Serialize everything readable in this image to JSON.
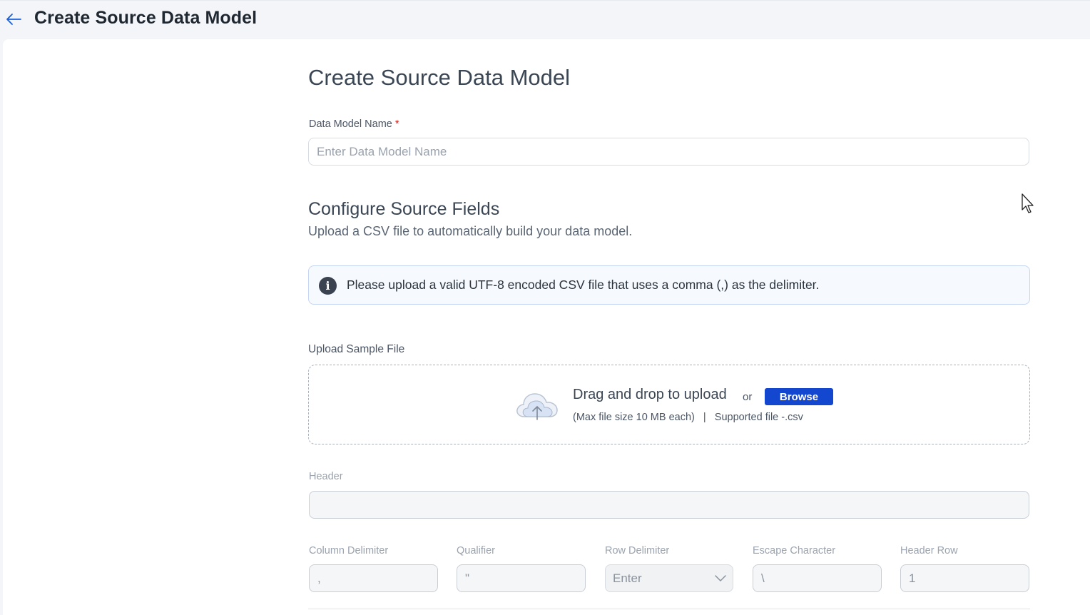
{
  "header": {
    "title": "Create Source Data Model",
    "back_icon": "arrow-left-icon"
  },
  "form": {
    "title": "Create Source Data Model",
    "data_model_name": {
      "label": "Data Model Name",
      "required_mark": "*",
      "value": "",
      "placeholder": "Enter Data Model Name"
    }
  },
  "configure": {
    "title": "Configure Source Fields",
    "subtitle": "Upload a CSV file to automatically build your data model.",
    "info_icon": "info-icon",
    "info_glyph": "i",
    "info_text": "Please upload a valid UTF-8 encoded CSV file that uses a comma (,) as the delimiter."
  },
  "upload": {
    "label": "Upload Sample File",
    "icon": "cloud-upload-icon",
    "drag_text": "Drag and drop to upload",
    "or_text": "or",
    "browse_label": "Browse",
    "hint": "(Max file size 10 MB each)   |   Supported file -.csv"
  },
  "header_field": {
    "label": "Header",
    "value": ""
  },
  "csv_options": {
    "column_delimiter": {
      "label": "Column Delimiter",
      "value": ","
    },
    "qualifier": {
      "label": "Qualifier",
      "value": "\""
    },
    "row_delimiter": {
      "label": "Row Delimiter",
      "value": "Enter"
    },
    "escape_character": {
      "label": "Escape Character",
      "value": "\\"
    },
    "header_row": {
      "label": "Header Row",
      "value": "1"
    }
  },
  "colors": {
    "accent": "#1447cf",
    "back_arrow": "#1b5fd9",
    "required": "#d0221c",
    "info_border": "#c5d6f2"
  }
}
